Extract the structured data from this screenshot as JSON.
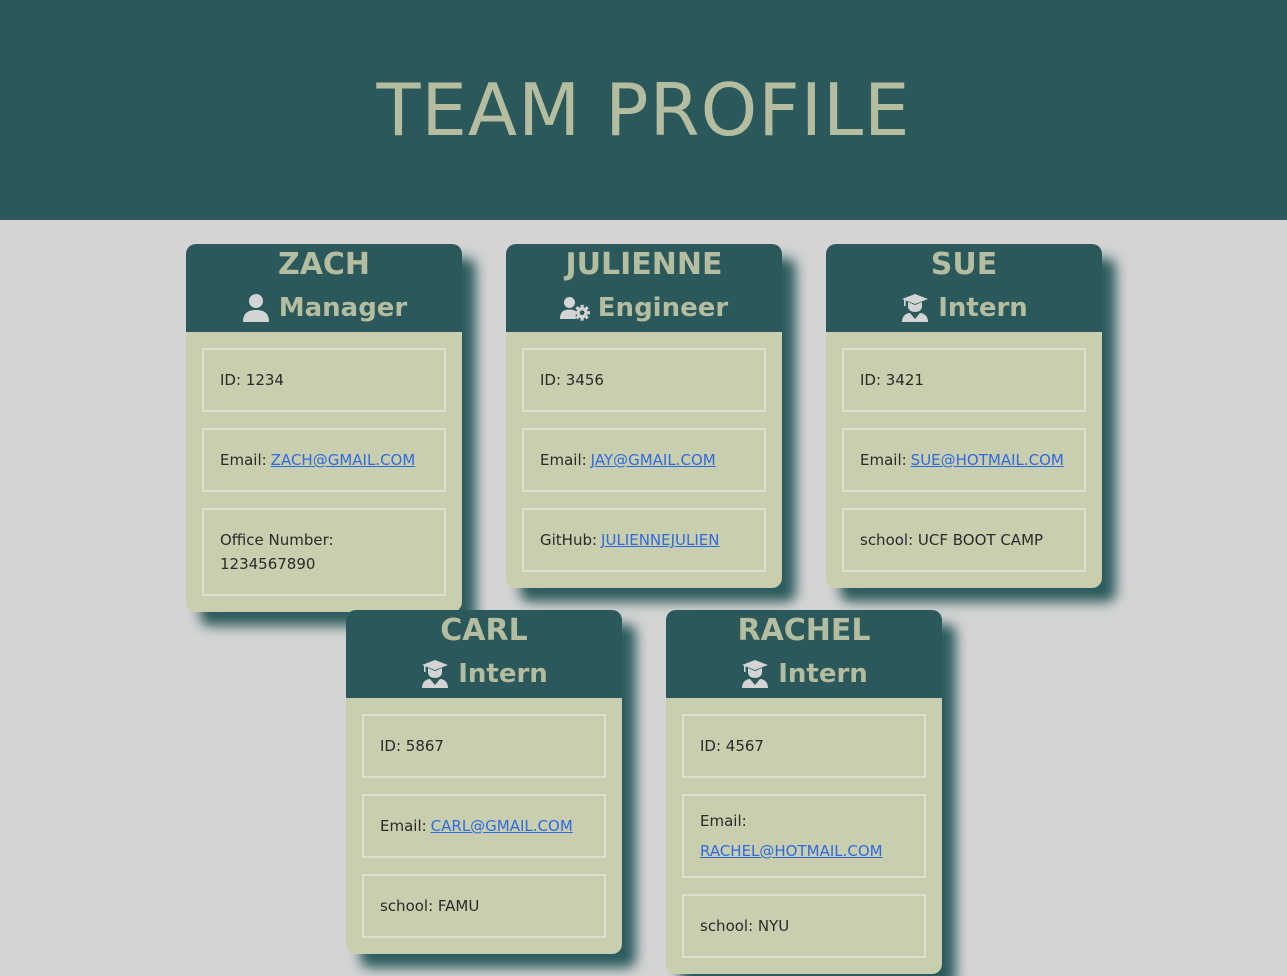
{
  "page": {
    "title": "TEAM PROFILE",
    "colors": {
      "header_bg": "#2b585a",
      "title_text": "#b4bd9f",
      "card_body": "#c9ceae",
      "page_bg": "#d4d4d4",
      "link": "#2f6be0"
    }
  },
  "cards": [
    {
      "name": "ZACH",
      "role": "Manager",
      "role_icon": "user-icon",
      "id_label": "ID: 1234",
      "email_label": "Email:",
      "email": "ZACH@GMAIL.COM",
      "extra_label": "Office Number: 1234567890"
    },
    {
      "name": "JULIENNE",
      "role": "Engineer",
      "role_icon": "user-gear-icon",
      "id_label": "ID: 3456",
      "email_label": "Email:",
      "email": "JAY@GMAIL.COM",
      "extra_label": "GitHub:",
      "extra_link": "JULIENNEJULIEN"
    },
    {
      "name": "SUE",
      "role": "Intern",
      "role_icon": "graduate-icon",
      "id_label": "ID: 3421",
      "email_label": "Email:",
      "email": "SUE@HOTMAIL.COM",
      "extra_label": "school: UCF BOOT CAMP"
    },
    {
      "name": "CARL",
      "role": "Intern",
      "role_icon": "graduate-icon",
      "id_label": "ID: 5867",
      "email_label": "Email:",
      "email": "CARL@GMAIL.COM",
      "extra_label": "school: FAMU"
    },
    {
      "name": "RACHEL",
      "role": "Intern",
      "role_icon": "graduate-icon",
      "id_label": "ID: 4567",
      "email_label": "Email:",
      "email": "RACHEL@HOTMAIL.COM",
      "extra_label": "school: NYU"
    }
  ]
}
